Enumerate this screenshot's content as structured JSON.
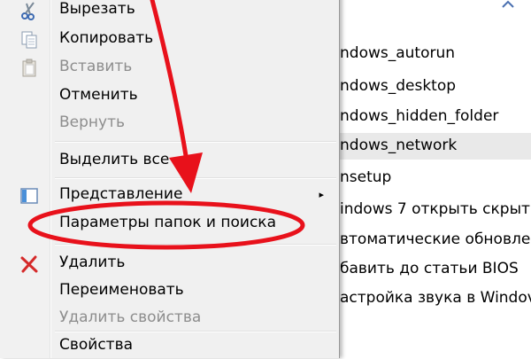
{
  "menu": {
    "items": [
      {
        "label": "Вырезать",
        "icon": "scissors-icon",
        "disabled": false
      },
      {
        "label": "Копировать",
        "icon": "copy-icon",
        "disabled": false
      },
      {
        "label": "Вставить",
        "icon": "paste-icon",
        "disabled": true
      },
      {
        "label": "Отменить",
        "icon": "",
        "disabled": false
      },
      {
        "label": "Вернуть",
        "icon": "",
        "disabled": true
      },
      {
        "label": "Выделить все",
        "icon": "",
        "disabled": false
      },
      {
        "label": "Представление",
        "icon": "view-icon",
        "disabled": false,
        "submenu": true
      },
      {
        "label": "Параметры папок и поиска",
        "icon": "",
        "disabled": false
      },
      {
        "label": "Удалить",
        "icon": "delete-x-icon",
        "disabled": false
      },
      {
        "label": "Переименовать",
        "icon": "",
        "disabled": false
      },
      {
        "label": "Удалить свойства",
        "icon": "",
        "disabled": true
      },
      {
        "label": "Свойства",
        "icon": "",
        "disabled": false
      }
    ],
    "submenu_glyph": "▸"
  },
  "files": {
    "items": [
      {
        "name": "ndows_autorun",
        "selected": false
      },
      {
        "name": "ndows_desktop",
        "selected": false
      },
      {
        "name": "ndows_hidden_folder",
        "selected": false
      },
      {
        "name": "ndows_network",
        "selected": true
      },
      {
        "name": "nsetup",
        "selected": false
      },
      {
        "name": "indows 7 открыть скрыт",
        "selected": false
      },
      {
        "name": "втоматические обновле",
        "selected": false
      },
      {
        "name": "бавить до статьи BIOS",
        "selected": false
      },
      {
        "name": "астройка звука в Windov",
        "selected": false
      }
    ]
  },
  "colors": {
    "annotation": "#e8111b",
    "menu_bg": "#f0f0f0",
    "disabled_text": "#8d8d8d"
  }
}
